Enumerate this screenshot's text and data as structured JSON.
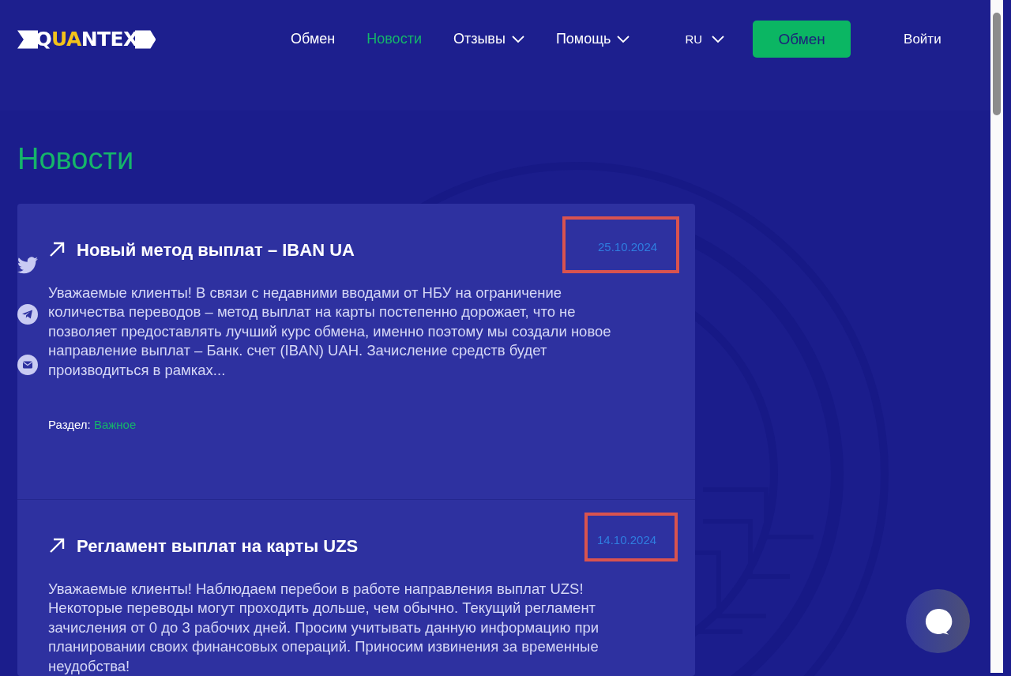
{
  "logo": {
    "text": "QUANTEX"
  },
  "nav": [
    {
      "label": "Обмен",
      "selected": false,
      "dropdown": false
    },
    {
      "label": "Новости",
      "selected": true,
      "dropdown": false
    },
    {
      "label": "Отзывы",
      "selected": false,
      "dropdown": true
    },
    {
      "label": "Помощь",
      "selected": false,
      "dropdown": true
    }
  ],
  "language": "RU",
  "exchange_button": "Обмен",
  "login": "Войти",
  "page_title": "Новости",
  "share_icons": [
    {
      "kind": "twitter"
    },
    {
      "kind": "telegram"
    },
    {
      "kind": "mail"
    }
  ],
  "news": [
    {
      "title": "Новый метод выплат – IBAN UA",
      "date": "25.10.2024",
      "highlighted": true,
      "text": "Уважаемые клиенты! В связи с недавними вводами от НБУ на ограничение количества переводов – метод выплат на карты постепенно дорожает, что не позволяет предоставлять лучший курс обмена, именно поэтому мы создали новое направление выплат – Банк. счет (IBAN) UAH. Зачисление средств будет производиться в рамках...",
      "section_label": "Раздел:",
      "section": "Важное"
    },
    {
      "title": "Регламент выплат на карты UZS",
      "date": "14.10.2024",
      "highlighted": true,
      "text": "Уважаемые клиенты! Наблюдаем перебои в работе направления выплат UZS! Некоторые переводы могут проходить дольше, чем обычно. Текущий регламент зачисления от 0 до 3 рабочих дней. Просим учитывать данную информацию при планировании своих финансовых операций. Приносим извинения за временные неудобства!"
    }
  ]
}
